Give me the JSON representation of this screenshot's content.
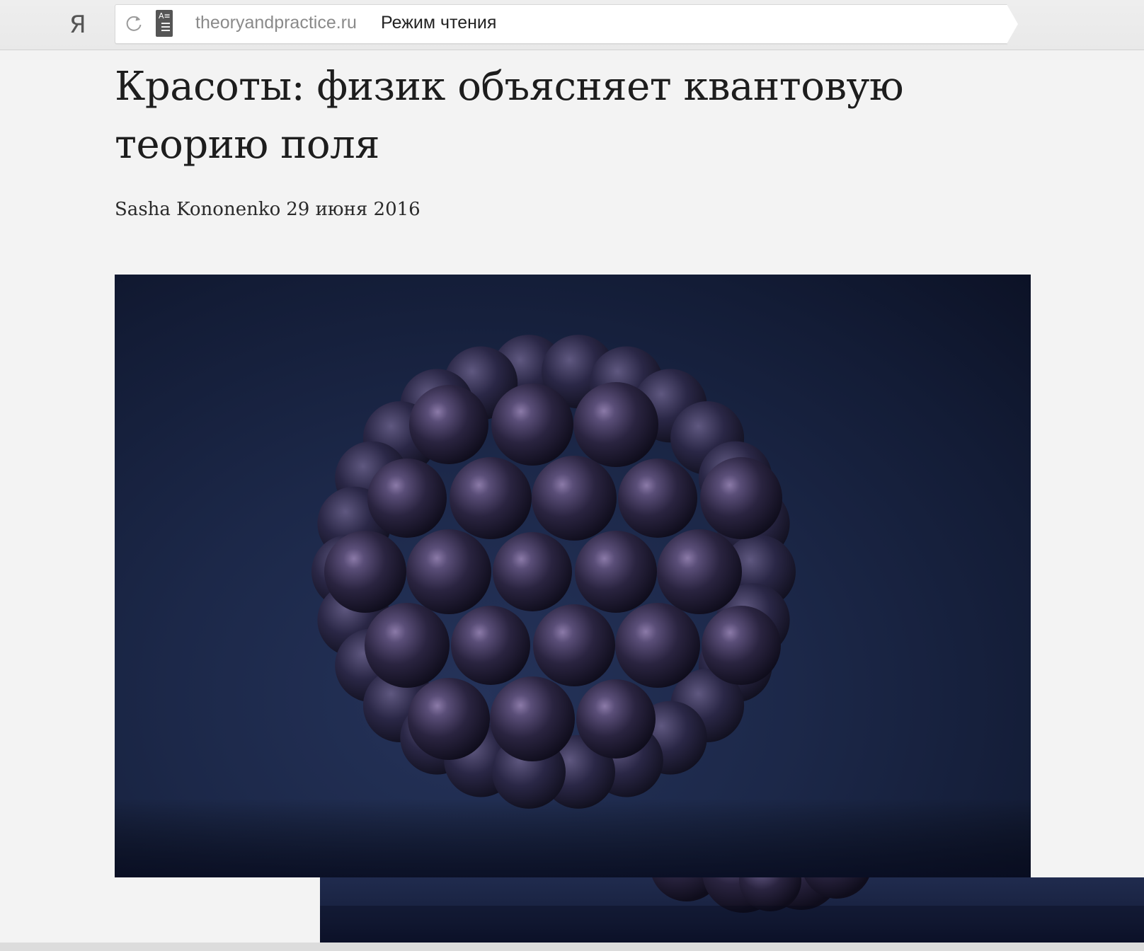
{
  "browser": {
    "logo": "Я",
    "url_domain": "theoryandpractice.ru",
    "mode_label": "Режим чтения",
    "reader_icon_glyph": "A≡"
  },
  "article": {
    "title": "Красоты: физик объясняет квантовую теорию поля",
    "author": "Sasha Kononenko",
    "date": "29 июня 2016"
  },
  "hero_image": {
    "subject": "cluster of dark purple spheres",
    "colors": {
      "background": "#1c2849",
      "sphere": "#2a2440",
      "highlight": "#8b7aa8"
    }
  }
}
